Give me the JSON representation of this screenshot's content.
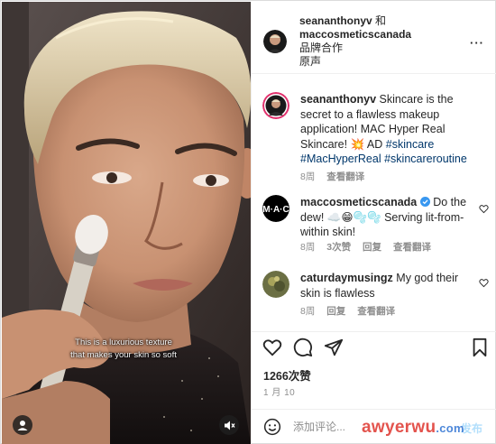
{
  "post": {
    "author": "seananthonyv",
    "connector": "和",
    "coauthor": "maccosmeticscanada",
    "subtitle_line1": "品牌合作",
    "subtitle_line2": "原声",
    "more": "···"
  },
  "media": {
    "caption_line1": "This is a luxurious texture",
    "caption_line2": "that makes your skin so soft"
  },
  "comments": [
    {
      "user": "seananthonyv",
      "text": "Skincare is the secret to a flawless makeup application! MAC Hyper Real Skincare! 💥 AD",
      "tags": "#skincare #MacHyperReal #skincareroutine",
      "time": "8周",
      "translate": "查看翻译"
    },
    {
      "user": "maccosmeticscanada",
      "text": "Do the dew! ☁️😁🫧🫧 Serving lit-from-within skin!",
      "time": "8周",
      "likes": "3次赞",
      "reply": "回复",
      "translate": "查看翻译"
    },
    {
      "user": "caturdaymusingz",
      "text": "My god their skin is flawless",
      "time": "8周",
      "reply": "回复",
      "translate": "查看翻译"
    }
  ],
  "stats": {
    "likes": "1266次赞",
    "date": "1 月 10"
  },
  "composer": {
    "placeholder": "添加评论...",
    "post": "发布"
  },
  "watermark": {
    "text": "awyerwu",
    "suffix": ".com"
  },
  "colors": {
    "link": "#00376b",
    "muted": "#8e8e8e",
    "verified": "#3897f0",
    "post_disabled": "#b2dffc"
  }
}
